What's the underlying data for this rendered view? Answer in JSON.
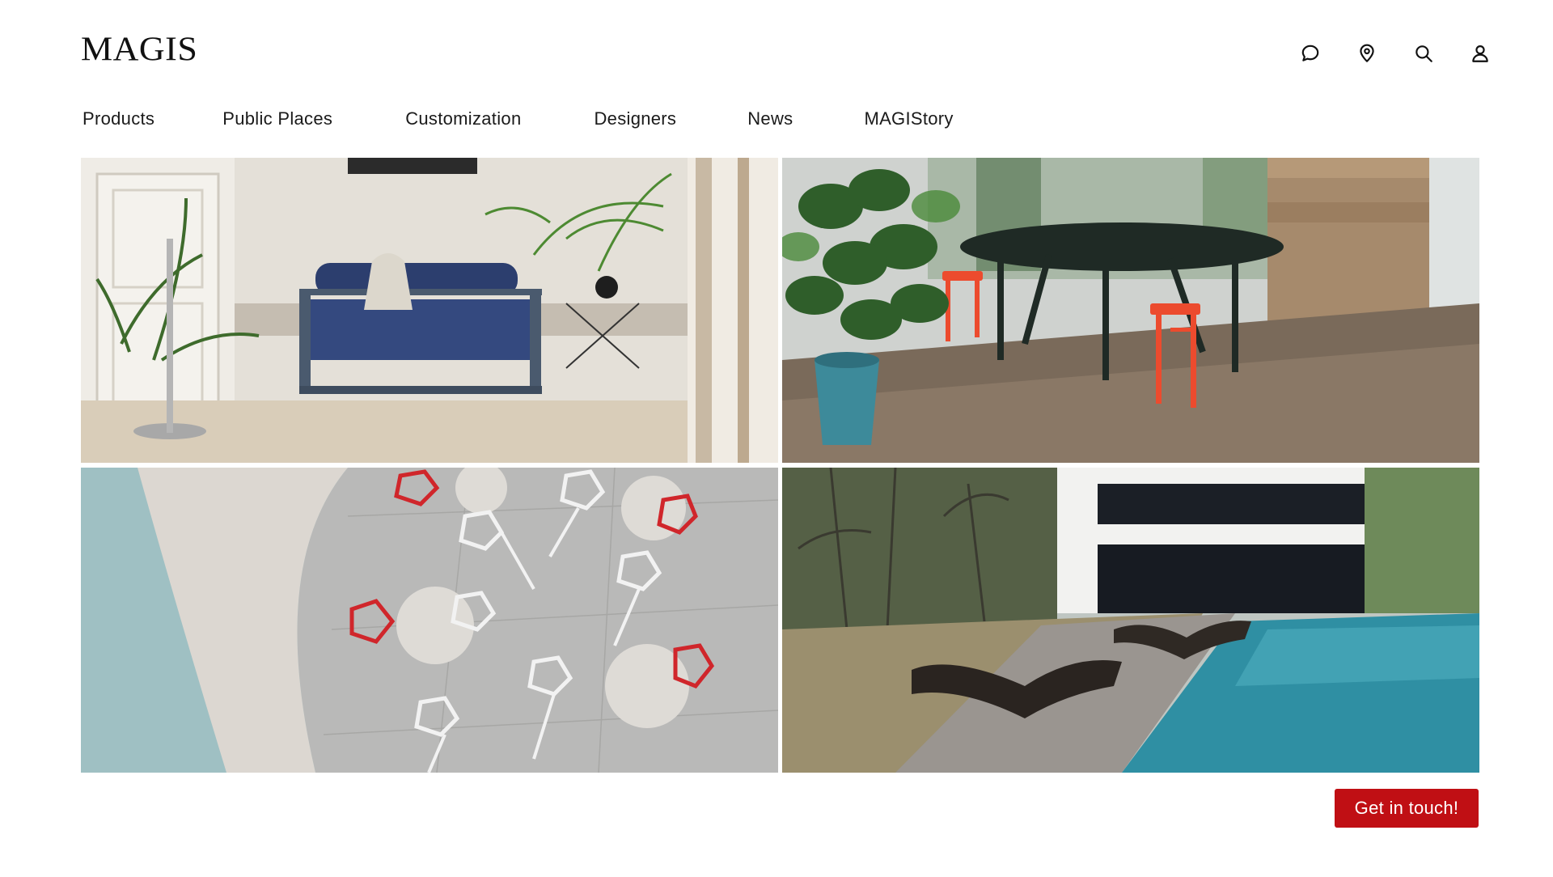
{
  "brand": {
    "logo_text": "MAGIS"
  },
  "header_icons": [
    "chat-icon",
    "location-pin-icon",
    "search-icon",
    "user-icon"
  ],
  "nav": {
    "items": [
      {
        "label": "Products"
      },
      {
        "label": "Public Places"
      },
      {
        "label": "Customization"
      },
      {
        "label": "Designers"
      },
      {
        "label": "News"
      },
      {
        "label": "MAGIStory"
      }
    ]
  },
  "tiles": [
    {
      "subject": "blue sofa in living room with plants"
    },
    {
      "subject": "round table with red stools and fiddle leaf plant"
    },
    {
      "subject": "red and white faceted stools with round tables, top view"
    },
    {
      "subject": "dark lounge chairs beside pool and modern house"
    }
  ],
  "cta": {
    "label": "Get in touch!"
  },
  "colors": {
    "accent": "#c00f14",
    "text": "#1a1a1a",
    "background": "#ffffff"
  }
}
